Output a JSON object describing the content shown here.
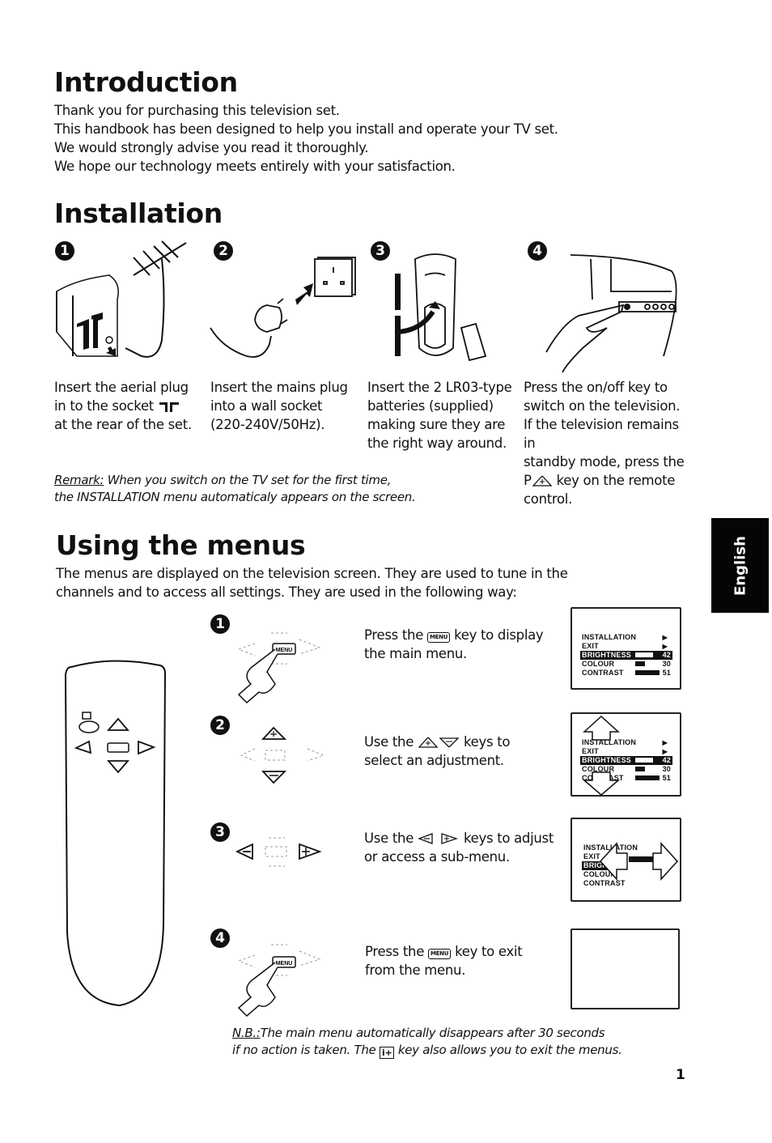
{
  "intro": {
    "title": "Introduction",
    "lines": [
      "Thank you for purchasing this television set.",
      "This handbook has been designed to help you install and operate your TV set.",
      "We would strongly advise you read it thoroughly.",
      "We hope our technology meets entirely with your satisfaction."
    ]
  },
  "installation": {
    "title": "Installation",
    "steps": [
      {
        "number": "1",
        "lines": [
          "Insert the aerial plug",
          "in to the socket",
          "at the rear of the set."
        ]
      },
      {
        "number": "2",
        "lines": [
          "Insert the mains plug",
          "into a wall socket",
          "(220-240V/50Hz)."
        ]
      },
      {
        "number": "3",
        "lines": [
          "Insert the 2 LR03-type",
          "batteries (supplied)",
          "making sure they are",
          "the right way around."
        ]
      },
      {
        "number": "4",
        "lines": [
          "Press the on/off key to",
          "switch on the television.",
          "If the television remains in",
          "standby mode, press the",
          "key on the remote",
          "control."
        ],
        "key_prefix": "P"
      }
    ],
    "remark": {
      "label": "Remark:",
      "line1": " When you switch on the TV set for the first time,",
      "line2": "the INSTALLATION menu automaticaly appears on the screen."
    }
  },
  "menus": {
    "title": "Using the menus",
    "intro_lines": [
      "The menus are displayed on the television screen. They are used to tune in the",
      "channels and to access all settings. They are used in the following way:"
    ],
    "steps": [
      {
        "number": "1",
        "pre": "Press the",
        "key": "MENU",
        "post": "key to display",
        "line2": "the main menu."
      },
      {
        "number": "2",
        "pre": "Use the",
        "post": "keys to",
        "line2": "select an adjustment."
      },
      {
        "number": "3",
        "pre": "Use the",
        "post": "keys to adjust",
        "line2": "or access a sub-menu."
      },
      {
        "number": "4",
        "pre": "Press the",
        "key": "MENU",
        "post": "key to exit",
        "line2": "from the menu."
      }
    ],
    "screen_menu": [
      {
        "label": "INSTALLATION",
        "arrow": "▶"
      },
      {
        "label": "EXIT",
        "arrow": "▶"
      },
      {
        "label": "BRIGHTNESS",
        "value": "42",
        "selected": true,
        "level": 0.42
      },
      {
        "label": "COLOUR",
        "value": "30",
        "level": 0.3
      },
      {
        "label": "CONTRAST",
        "value": "51",
        "level": 0.51
      }
    ],
    "remote_keys": {
      "menu": "MENU",
      "info": "i+"
    },
    "nb": {
      "label": "N.B.:",
      "line1": "The main menu automatically disappears after 30 seconds",
      "line2_pre": "if no action is taken. The",
      "line2_post": "key also allows you to exit the menus.",
      "key": "i+"
    }
  },
  "side_tab": {
    "label": "English"
  },
  "page_number": "1"
}
